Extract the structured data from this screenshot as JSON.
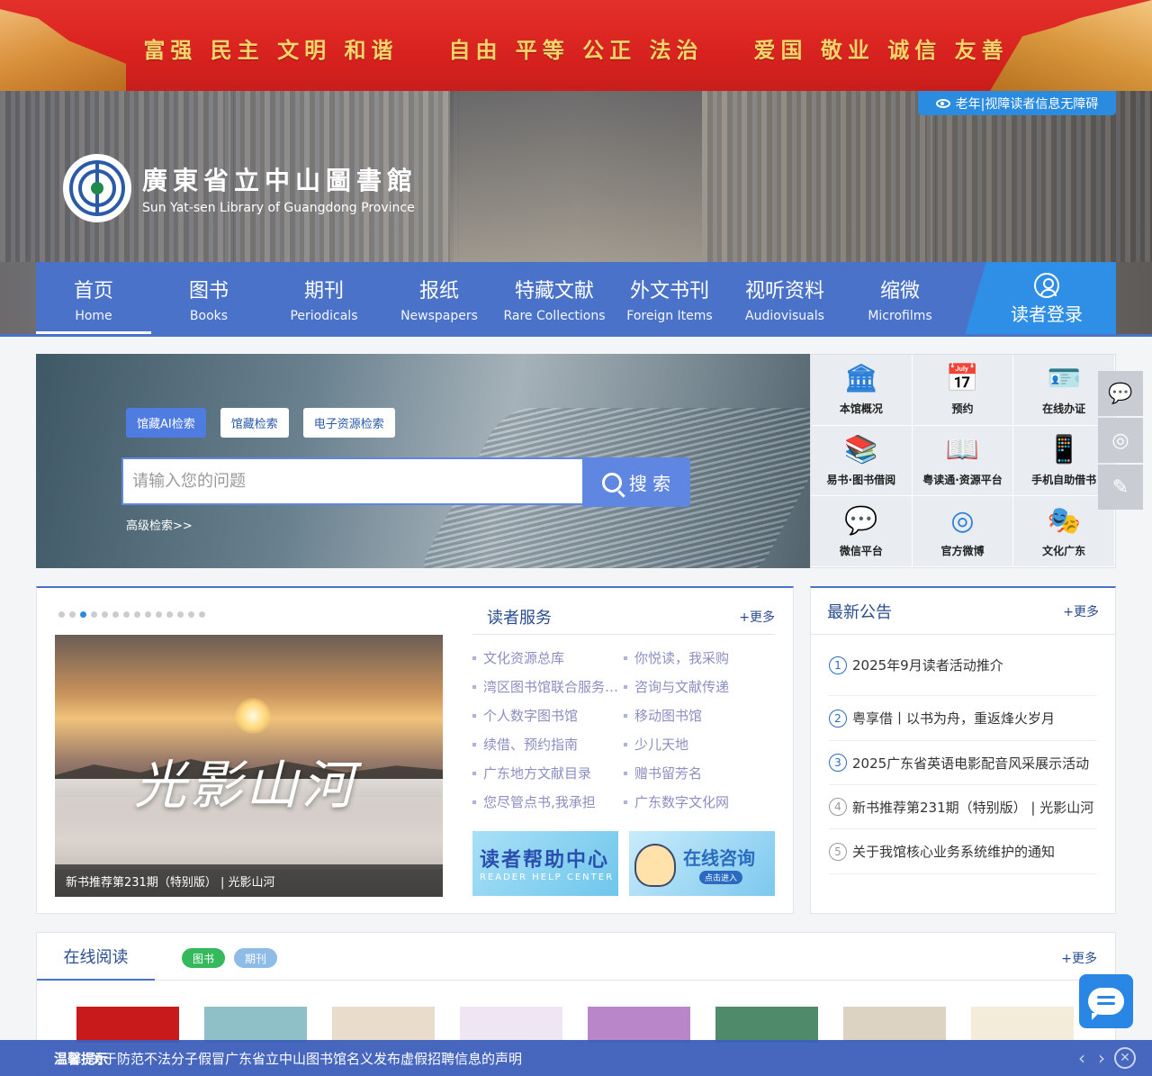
{
  "banner": {
    "slogans": [
      "富强 民主 文明 和谐",
      "自由 平等 公正 法治",
      "爱国 敬业 诚信 友善"
    ]
  },
  "header": {
    "accessibility_label": "老年|视障读者信息无障碍",
    "logo_cn": "廣東省立中山圖書館",
    "logo_en": "Sun Yat-sen Library of Guangdong Province"
  },
  "nav": {
    "items": [
      {
        "cn": "首页",
        "en": "Home"
      },
      {
        "cn": "图书",
        "en": "Books"
      },
      {
        "cn": "期刊",
        "en": "Periodicals"
      },
      {
        "cn": "报纸",
        "en": "Newspapers"
      },
      {
        "cn": "特藏文献",
        "en": "Rare Collections"
      },
      {
        "cn": "外文书刊",
        "en": "Foreign Items"
      },
      {
        "cn": "视听资料",
        "en": "Audiovisuals"
      },
      {
        "cn": "缩微",
        "en": "Microfilms"
      }
    ],
    "login_label": "读者登录"
  },
  "search": {
    "tabs": [
      "馆藏AI检索",
      "馆藏检索",
      "电子资源检索"
    ],
    "placeholder": "请输入您的问题",
    "button_label": "搜 索",
    "advanced_label": "高级检索>>"
  },
  "quick_links": [
    {
      "label": "本馆概况",
      "icon": "library-building-icon",
      "glyph": "🏛"
    },
    {
      "label": "预约",
      "icon": "calendar-clock-icon",
      "glyph": "📅"
    },
    {
      "label": "在线办证",
      "icon": "id-card-icon",
      "glyph": "🪪"
    },
    {
      "label": "易书·图书借阅",
      "icon": "book-lending-icon",
      "glyph": "📚"
    },
    {
      "label": "粤读通·资源平台",
      "icon": "open-book-icon",
      "glyph": "📖"
    },
    {
      "label": "手机自助借书",
      "icon": "mobile-phone-icon",
      "glyph": "📱"
    },
    {
      "label": "微信平台",
      "icon": "wechat-icon",
      "glyph": "💬"
    },
    {
      "label": "官方微博",
      "icon": "weibo-icon",
      "glyph": "◎"
    },
    {
      "label": "文化广东",
      "icon": "culture-guangdong-icon",
      "glyph": "🎭"
    }
  ],
  "side_float": [
    {
      "icon": "wechat-icon",
      "glyph": "💬"
    },
    {
      "icon": "weibo-icon",
      "glyph": "◎"
    },
    {
      "icon": "feedback-edit-icon",
      "glyph": "✎"
    }
  ],
  "carousel": {
    "slide_count": 14,
    "active_index": 2,
    "slide_title": "光影山河",
    "caption": "新书推荐第231期（特别版） | 光影山河"
  },
  "reader_service": {
    "title": "读者服务",
    "more": "+更多",
    "items": [
      "文化资源总库",
      "你悦读，我采购",
      "湾区图书馆联合服务平台",
      "咨询与文献传递",
      "个人数字图书馆",
      "移动图书馆",
      "续借、预约指南",
      "少儿天地",
      "广东地方文献目录",
      "赠书留芳名",
      "您尽管点书,我承担",
      "广东数字文化网"
    ],
    "promo_help_title": "读者帮助中心",
    "promo_help_sub": "READER HELP CENTER",
    "promo_online_title": "在线咨询",
    "promo_online_sub": "点击进入"
  },
  "notices": {
    "title": "最新公告",
    "more": "+更多",
    "items": [
      {
        "num": "1",
        "text": "2025年9月读者活动推介"
      },
      {
        "num": "2",
        "text": "粤享借丨以书为舟，重返烽火岁月"
      },
      {
        "num": "3",
        "text": "2025广东省英语电影配音风采展示活动"
      },
      {
        "num": "4",
        "text": "新书推荐第231期（特别版） | 光影山河"
      },
      {
        "num": "5",
        "text": "关于我馆核心业务系统维护的通知"
      }
    ]
  },
  "online_reading": {
    "title": "在线阅读",
    "tag_books": "图书",
    "tag_periodicals": "期刊",
    "more": "+更多",
    "covers": [
      {
        "color": "#c8191b"
      },
      {
        "color": "#8fc0c8"
      },
      {
        "color": "#e9dccb"
      },
      {
        "color": "#efe6f4"
      },
      {
        "color": "#b886c9"
      },
      {
        "color": "#4f8a6a"
      },
      {
        "color": "#dcd3c2"
      },
      {
        "color": "#f3ecd9"
      }
    ]
  },
  "bottom_bar": {
    "label": "温馨提示",
    "message": "关于防范不法分子假冒广东省立中山图书馆名义发布虚假招聘信息的声明"
  }
}
